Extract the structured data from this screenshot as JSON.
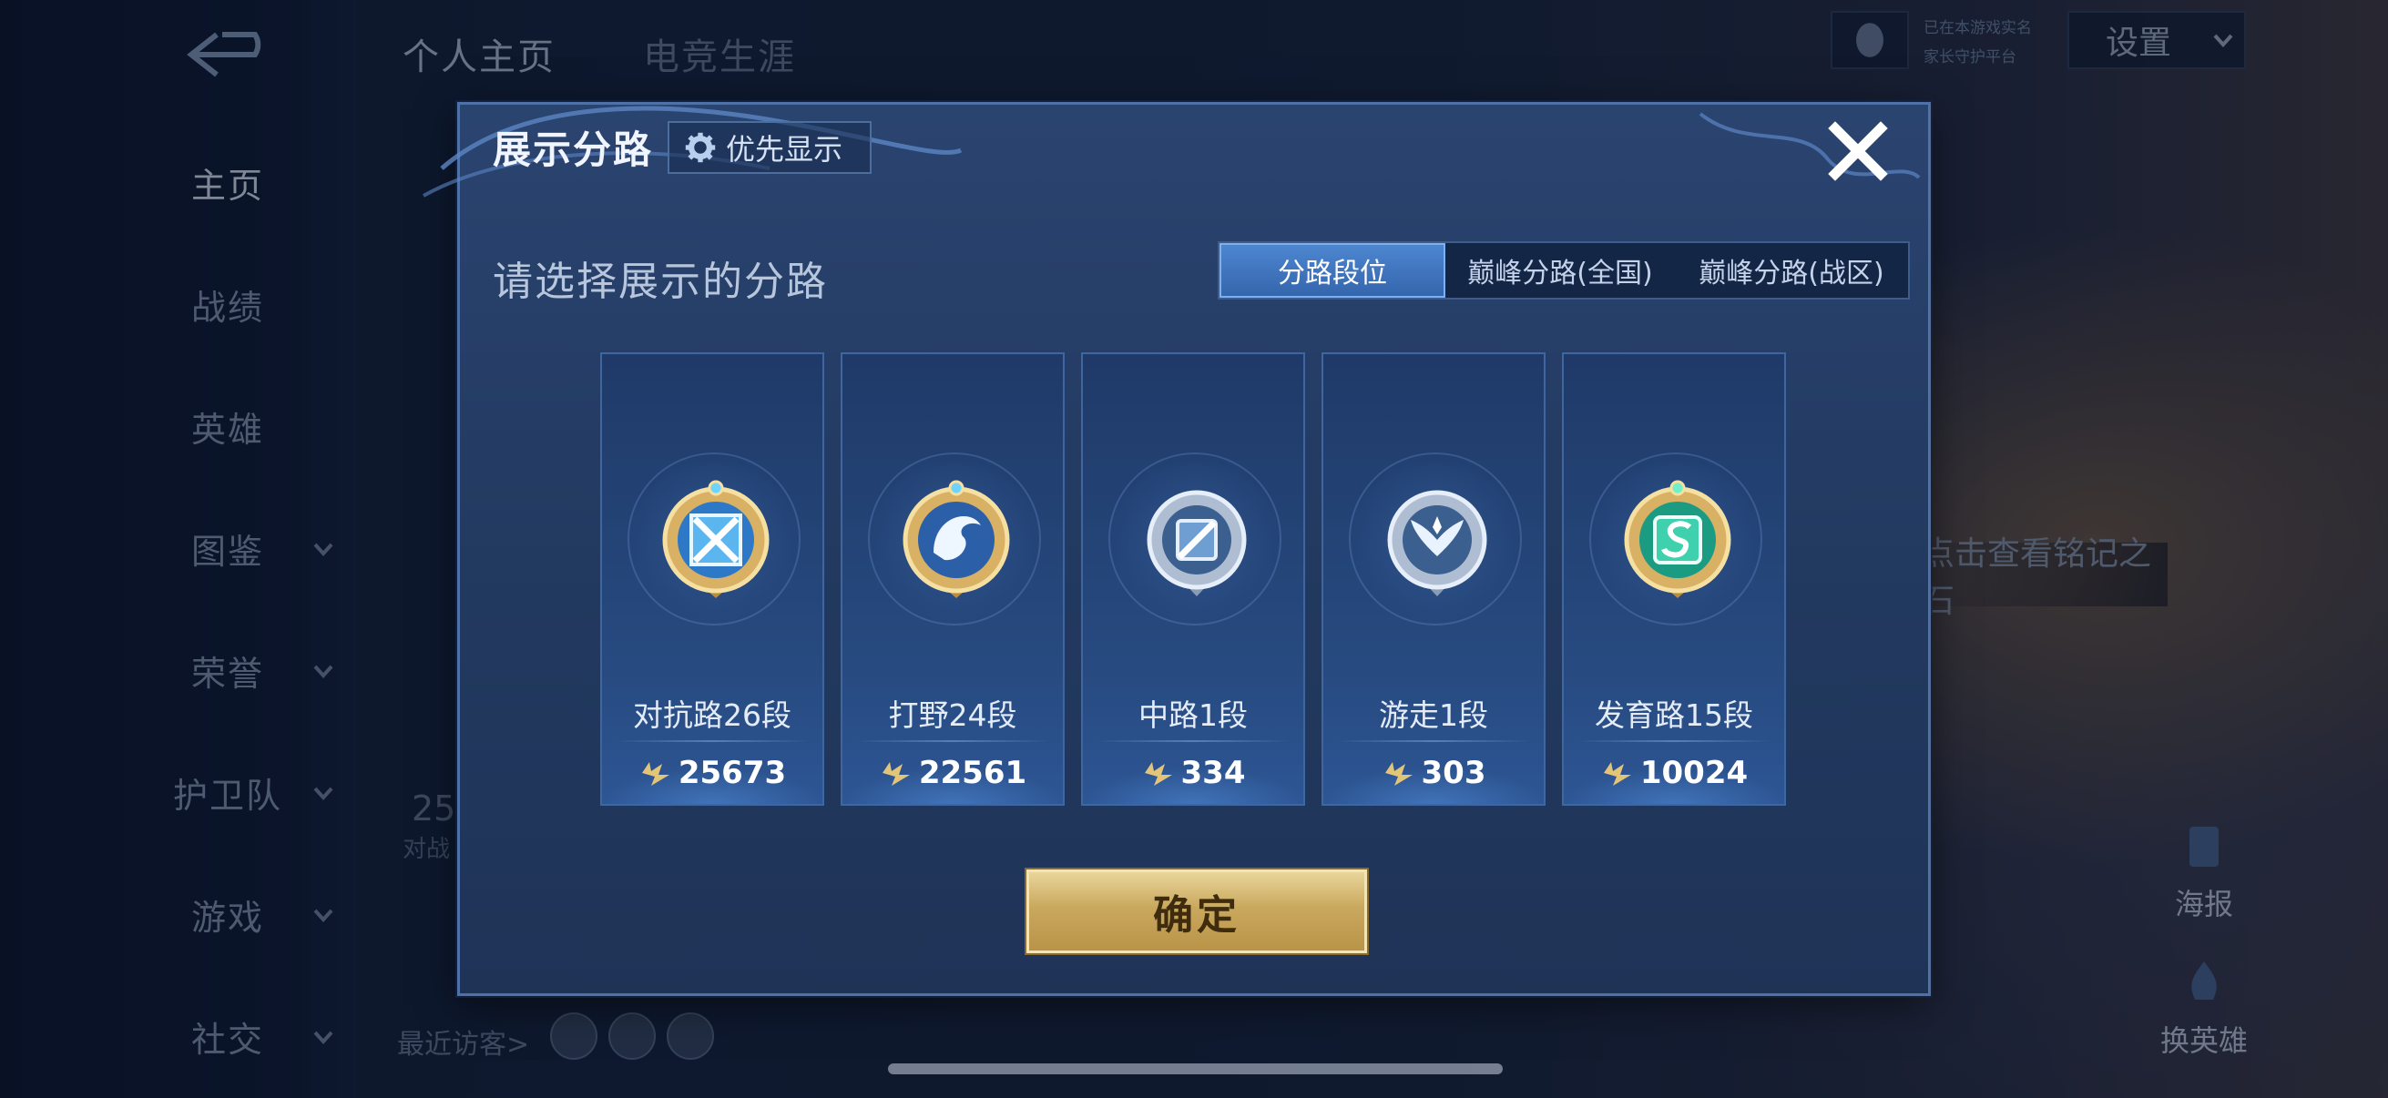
{
  "sidebar": {
    "items": [
      {
        "label": "主页",
        "active": true
      },
      {
        "label": "战绩"
      },
      {
        "label": "英雄"
      },
      {
        "label": "图鉴",
        "expandable": true
      },
      {
        "label": "荣誉",
        "expandable": true
      },
      {
        "label": "护卫队",
        "expandable": true
      },
      {
        "label": "游戏",
        "expandable": true
      },
      {
        "label": "社交",
        "expandable": true
      }
    ]
  },
  "header": {
    "tabs": [
      "个人主页",
      "电竞生涯"
    ],
    "settings_label": "设置",
    "status_line1": "已在本游戏实名",
    "status_line2": "家长守护平台"
  },
  "background": {
    "inscription_label": "点击查看铭记之石",
    "poster_label": "海报",
    "change_hero_label": "换英雄",
    "recent_visitors_label": "最近访客>",
    "partial_stat": "25",
    "partial_stat_label": "对战"
  },
  "dialog": {
    "title": "展示分路",
    "priority_label": "优先显示",
    "subtitle": "请选择展示的分路",
    "tabs": [
      {
        "label": "分路段位",
        "active": true
      },
      {
        "label": "巅峰分路(全国)"
      },
      {
        "label": "巅峰分路(战区)"
      }
    ],
    "cards": [
      {
        "label": "对抗路26段",
        "score": "25673",
        "badge": "gold-crossed-swords-icon",
        "tier": "gold"
      },
      {
        "label": "打野24段",
        "score": "22561",
        "badge": "gold-dragon-icon",
        "tier": "gold"
      },
      {
        "label": "中路1段",
        "score": "334",
        "badge": "silver-mid-lane-icon",
        "tier": "silver"
      },
      {
        "label": "游走1段",
        "score": "303",
        "badge": "silver-wings-icon",
        "tier": "silver"
      },
      {
        "label": "发育路15段",
        "score": "10024",
        "badge": "gold-emerald-icon",
        "tier": "gold"
      }
    ],
    "confirm_label": "确定"
  },
  "colors": {
    "accent_blue": "#3f77c2",
    "gold": "#c9a85e",
    "dialog_bg": "#22395f"
  }
}
